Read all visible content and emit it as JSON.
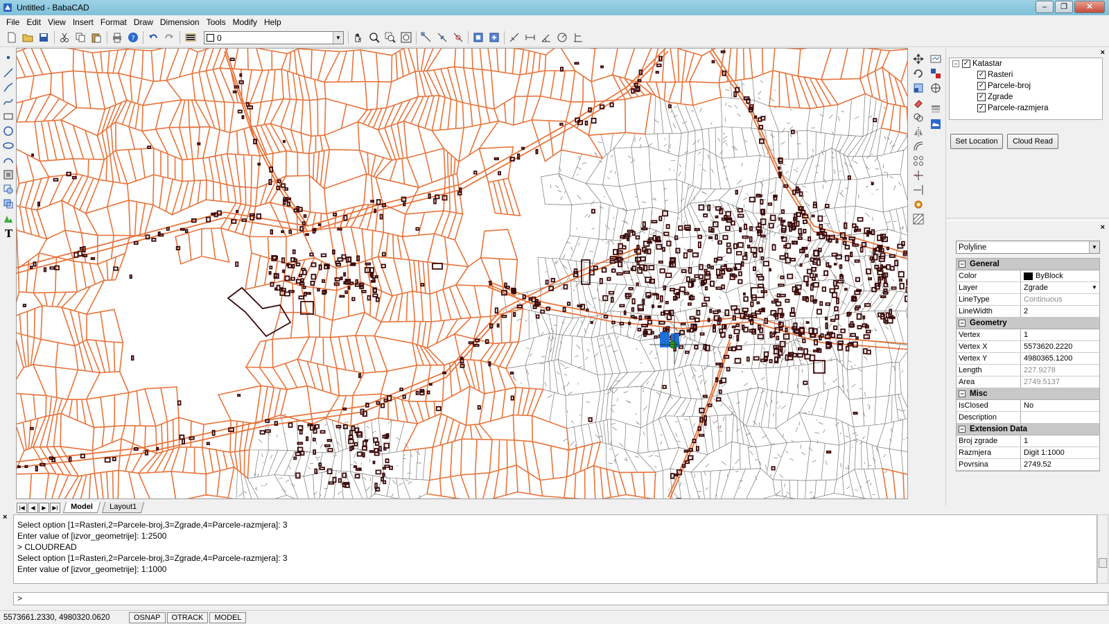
{
  "window": {
    "title": "Untitled - BabaCAD",
    "min": "‒",
    "max": "❐",
    "close": "✕"
  },
  "menu": [
    "File",
    "Edit",
    "View",
    "Insert",
    "Format",
    "Draw",
    "Dimension",
    "Tools",
    "Modify",
    "Help"
  ],
  "toolbar": {
    "layer_value": "0"
  },
  "tabs": {
    "model": "Model",
    "layout": "Layout1"
  },
  "layer_tree": {
    "root": "Katastar",
    "items": [
      "Rasteri",
      "Parcele-broj",
      "Zgrade",
      "Parcele-razmjera"
    ]
  },
  "buttons": {
    "set_location": "Set Location",
    "cloud_read": "Cloud Read"
  },
  "properties": {
    "entity_type": "Polyline",
    "general": {
      "title": "General",
      "color_label": "Color",
      "color_value": "ByBlock",
      "layer_label": "Layer",
      "layer_value": "Zgrade",
      "linetype_label": "LineType",
      "linetype_value": "Continuous",
      "linewidth_label": "LineWidth",
      "linewidth_value": "2"
    },
    "geometry": {
      "title": "Geometry",
      "vertex_label": "Vertex",
      "vertex_value": "1",
      "vx_label": "Vertex X",
      "vx_value": "5573620.2220",
      "vy_label": "Vertex Y",
      "vy_value": "4980365.1200",
      "length_label": "Length",
      "length_value": "227.9278",
      "area_label": "Area",
      "area_value": "2749.5137"
    },
    "misc": {
      "title": "Misc",
      "isclosed_label": "IsClosed",
      "isclosed_value": "No",
      "description_label": "Description",
      "description_value": ""
    },
    "extension": {
      "title": "Extension Data",
      "broj_label": "Broj zgrade",
      "broj_value": "1",
      "razmjera_label": "Razmjera",
      "razmjera_value": "Digit 1:1000",
      "povrsina_label": "Povrsina",
      "povrsina_value": "2749.52"
    }
  },
  "command": {
    "lines": [
      "Select option [1=Rasteri,2=Parcele-broj,3=Zgrade,4=Parcele-razmjera]: 3",
      "Enter value of [izvor_geometrije]: 1:2500",
      "> CLOUDREAD",
      "Select option [1=Rasteri,2=Parcele-broj,3=Zgrade,4=Parcele-razmjera]: 3",
      "Enter value of [izvor_geometrije]: 1:1000"
    ],
    "prompt": ">"
  },
  "status": {
    "coords": "5573661.2330, 4980320.0620",
    "osnap": "OSNAP",
    "otrack": "OTRACK",
    "model": "MODEL"
  },
  "colors": {
    "parcel_orange": "#e8733a",
    "building": "#3a0808",
    "parcel_gray": "#777777",
    "selection": "#1e6fd8"
  }
}
